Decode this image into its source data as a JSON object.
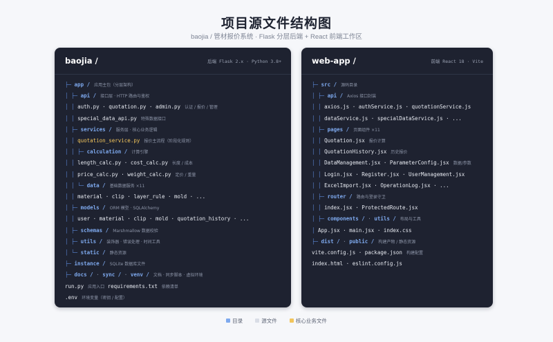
{
  "title": "项目源文件结构图",
  "subtitle": "baojia  /  管材报价系统 · Flask 分层后端  +  React 前端工作区",
  "colors": {
    "directory": "#7ea9ee",
    "source": "#e6e9f0",
    "core": "#f2c55c",
    "tree": "#5b87d6",
    "panel_bg": "#1e2230"
  },
  "panels": [
    {
      "name": "baojia /",
      "meta": "后端 Flask 2.x · Python 3.8+",
      "rows": [
        {
          "segs": [
            {
              "t": "├─ ",
              "k": "tree"
            },
            {
              "t": "app /",
              "k": "dir"
            }
          ],
          "note": "应用主包（分层架构）"
        },
        {
          "segs": [
            {
              "t": "│   ├─ ",
              "k": "tree"
            },
            {
              "t": "api /",
              "k": "dir"
            }
          ],
          "note": "接口层 · HTTP 路由与鉴权"
        },
        {
          "segs": [
            {
              "t": "│   │  ",
              "k": "tree"
            },
            {
              "t": "auth.py · quotation.py · admin.py",
              "k": "file"
            }
          ],
          "note": "认证 / 报价 / 管理"
        },
        {
          "segs": [
            {
              "t": "│   │  ",
              "k": "tree"
            },
            {
              "t": "special_data_api.py",
              "k": "file"
            }
          ],
          "note": "特殊数据接口"
        },
        {
          "segs": [
            {
              "t": "│   ├─ ",
              "k": "tree"
            },
            {
              "t": "services /",
              "k": "dir"
            }
          ],
          "note": "服务层 · 核心业务逻辑"
        },
        {
          "segs": [
            {
              "t": "│   │  ",
              "k": "tree"
            },
            {
              "t": "quotation_service.py",
              "k": "core"
            }
          ],
          "note": "报价主流程（阶段化规则）"
        },
        {
          "segs": [
            {
              "t": "│   │  ├─ ",
              "k": "tree"
            },
            {
              "t": "calculation /",
              "k": "dir"
            }
          ],
          "note": "计算引擎"
        },
        {
          "segs": [
            {
              "t": "│   │     ",
              "k": "tree"
            },
            {
              "t": "length_calc.py · cost_calc.py",
              "k": "file"
            }
          ],
          "note": "长度 / 成本"
        },
        {
          "segs": [
            {
              "t": "│   │     ",
              "k": "tree"
            },
            {
              "t": "price_calc.py · weight_calc.py",
              "k": "file"
            }
          ],
          "note": "定价 / 重量"
        },
        {
          "segs": [
            {
              "t": "│   │  └─ ",
              "k": "tree"
            },
            {
              "t": "data /",
              "k": "dir"
            }
          ],
          "note": "基础数据服务 ×11"
        },
        {
          "segs": [
            {
              "t": "│   │     ",
              "k": "tree"
            },
            {
              "t": "material · clip · layer_rule · mold · ...",
              "k": "file"
            }
          ],
          "note": ""
        },
        {
          "segs": [
            {
              "t": "│   ├─ ",
              "k": "tree"
            },
            {
              "t": "models /",
              "k": "dir"
            }
          ],
          "note": "ORM 模型 · SQLAlchemy"
        },
        {
          "segs": [
            {
              "t": "│   │  ",
              "k": "tree"
            },
            {
              "t": "user · material · clip · mold · quotation_history · ...",
              "k": "file"
            }
          ],
          "note": ""
        },
        {
          "segs": [
            {
              "t": "│   ├─ ",
              "k": "tree"
            },
            {
              "t": "schemas /",
              "k": "dir"
            }
          ],
          "note": "Marshmallow 数据校验"
        },
        {
          "segs": [
            {
              "t": "│   ├─ ",
              "k": "tree"
            },
            {
              "t": "utils /",
              "k": "dir"
            }
          ],
          "note": "装饰器 · 错误处理 · 时间工具"
        },
        {
          "segs": [
            {
              "t": "│   └─ ",
              "k": "tree"
            },
            {
              "t": "static /",
              "k": "dir"
            }
          ],
          "note": "静态资源"
        },
        {
          "segs": [
            {
              "t": "├─ ",
              "k": "tree"
            },
            {
              "t": "instance /",
              "k": "dir"
            }
          ],
          "note": "SQLite 数据库文件"
        },
        {
          "segs": [
            {
              "t": "├─ ",
              "k": "tree"
            },
            {
              "t": "docs /",
              "k": "dir"
            },
            {
              "t": "  ·  ",
              "k": "sep"
            },
            {
              "t": "sync /",
              "k": "dir"
            },
            {
              "t": "  ·  ",
              "k": "sep"
            },
            {
              "t": "venv /",
              "k": "dir"
            }
          ],
          "note": "文档 · 同步脚本 · 虚拟环境"
        },
        {
          "segs": [
            {
              "t": "run.py",
              "k": "file"
            }
          ],
          "note": "应用入口",
          "segs2": [
            {
              "t": "requirements.txt",
              "k": "file"
            }
          ],
          "note2": "依赖清单"
        },
        {
          "segs": [
            {
              "t": ".env",
              "k": "file"
            }
          ],
          "note": "环境变量（密钥 / 配置）"
        }
      ]
    },
    {
      "name": "web-app /",
      "meta": "前端 React 18 · Vite",
      "rows": [
        {
          "segs": [
            {
              "t": "├─ ",
              "k": "tree"
            },
            {
              "t": "src /",
              "k": "dir"
            }
          ],
          "note": "源码目录"
        },
        {
          "segs": [
            {
              "t": "│   ├─ ",
              "k": "tree"
            },
            {
              "t": "api /",
              "k": "dir"
            }
          ],
          "note": "Axios 接口封装"
        },
        {
          "segs": [
            {
              "t": "│   │  ",
              "k": "tree"
            },
            {
              "t": "axios.js · authService.js · quotationService.js",
              "k": "file"
            }
          ],
          "note": ""
        },
        {
          "segs": [
            {
              "t": "│   │  ",
              "k": "tree"
            },
            {
              "t": "dataService.js · specialDataService.js · ...",
              "k": "file"
            }
          ],
          "note": ""
        },
        {
          "segs": [
            {
              "t": "│   ├─ ",
              "k": "tree"
            },
            {
              "t": "pages /",
              "k": "dir"
            }
          ],
          "note": "页面组件 ×11"
        },
        {
          "segs": [
            {
              "t": "│   │  ",
              "k": "tree"
            },
            {
              "t": "Quotation.jsx",
              "k": "file"
            }
          ],
          "note": "报价计算"
        },
        {
          "segs": [
            {
              "t": "│   │  ",
              "k": "tree"
            },
            {
              "t": "QuotationHistory.jsx",
              "k": "file"
            }
          ],
          "note": "历史报价"
        },
        {
          "segs": [
            {
              "t": "│   │  ",
              "k": "tree"
            },
            {
              "t": "DataManagement.jsx · ParameterConfig.jsx",
              "k": "file"
            }
          ],
          "note": "数据/参数"
        },
        {
          "segs": [
            {
              "t": "│   │  ",
              "k": "tree"
            },
            {
              "t": "Login.jsx · Register.jsx · UserManagement.jsx",
              "k": "file"
            }
          ],
          "note": ""
        },
        {
          "segs": [
            {
              "t": "│   │  ",
              "k": "tree"
            },
            {
              "t": "ExcelImport.jsx · OperationLog.jsx · ...",
              "k": "file"
            }
          ],
          "note": ""
        },
        {
          "segs": [
            {
              "t": "│   ├─ ",
              "k": "tree"
            },
            {
              "t": "router /",
              "k": "dir"
            }
          ],
          "note": "路由与登录守卫"
        },
        {
          "segs": [
            {
              "t": "│   │  ",
              "k": "tree"
            },
            {
              "t": "index.jsx · ProtectedRoute.jsx",
              "k": "file"
            }
          ],
          "note": ""
        },
        {
          "segs": [
            {
              "t": "│   ├─ ",
              "k": "tree"
            },
            {
              "t": "components /",
              "k": "dir"
            },
            {
              "t": "  ·  ",
              "k": "sep"
            },
            {
              "t": "utils /",
              "k": "dir"
            }
          ],
          "note": "布局与工具"
        },
        {
          "segs": [
            {
              "t": "│   ",
              "k": "tree"
            },
            {
              "t": "App.jsx · main.jsx · index.css",
              "k": "file"
            }
          ],
          "note": ""
        },
        {
          "segs": [
            {
              "t": "├─ ",
              "k": "tree"
            },
            {
              "t": "dist /",
              "k": "dir"
            },
            {
              "t": "  ·  ",
              "k": "sep"
            },
            {
              "t": "public /",
              "k": "dir"
            }
          ],
          "note": "构建产物 / 静态资源"
        },
        {
          "segs": [
            {
              "t": "vite.config.js · package.json",
              "k": "file"
            }
          ],
          "note": "构建配置"
        },
        {
          "segs": [
            {
              "t": "index.html · eslint.config.js",
              "k": "file"
            }
          ],
          "note": ""
        }
      ]
    }
  ],
  "legend": [
    {
      "label": "目录",
      "color": "#7ea9ee"
    },
    {
      "label": "源文件",
      "color": "#d9dde6"
    },
    {
      "label": "核心业务文件",
      "color": "#f2c55c"
    }
  ]
}
